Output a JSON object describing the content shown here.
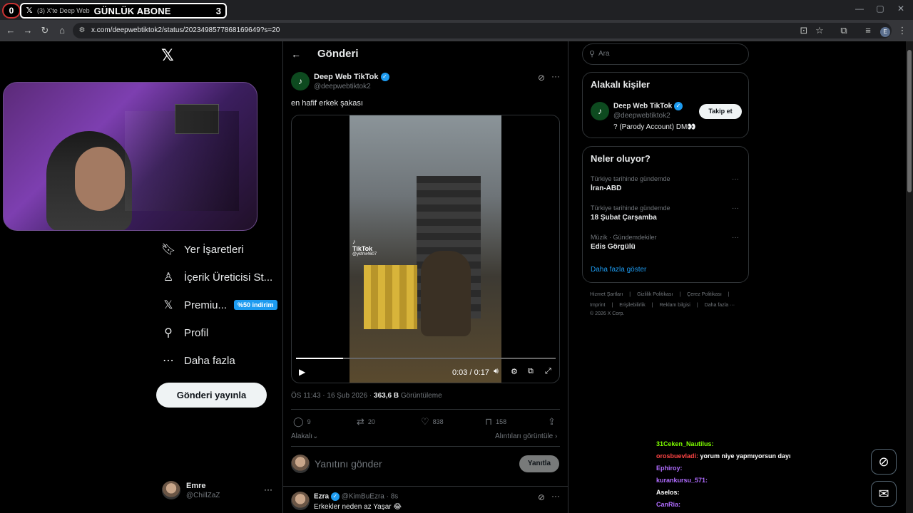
{
  "browser": {
    "counter_left": "0",
    "tab_title": "(3) X'te Deep Web",
    "tab_banner": "GÜNLÜK ABONE",
    "tab_count": "3",
    "url": "x.com/deepwebtiktok2/status/2023498577868169649?s=20",
    "profile_initial": "E"
  },
  "nav": {
    "bookmarks": "Yer İşaretleri",
    "creator_studio": "İçerik Üreticisi St...",
    "premium": "Premiu...",
    "premium_badge": "%50 indirim",
    "profile": "Profil",
    "more": "Daha fazla",
    "post_button": "Gönderi yayınla",
    "user_name": "Emre",
    "user_handle": "@ChillZaZ"
  },
  "post": {
    "header_title": "Gönderi",
    "author_name": "Deep Web TikTok",
    "author_handle": "@deepwebtiktok2",
    "text": "en hafif erkek şakası",
    "video_time": "0:03 / 0:17",
    "video_watermark": "TikTok",
    "video_watermark_user": "@ykfmr4607",
    "video_progress": 0.18,
    "meta_time": "ÖS 11:43 · 16 Şub 2026 · ",
    "meta_views": "363,6 B",
    "meta_views_label": " Görüntüleme",
    "replies": "9",
    "reposts": "20",
    "likes": "838",
    "bookmarks": "158",
    "related": "Alakalı",
    "view_quotes": "Alıntıları görüntüle",
    "reply_placeholder": "Yanıtını gönder",
    "reply_button": "Yanıtla"
  },
  "reply": {
    "name": "Ezra",
    "handle": "@KimBuEzra · 8s",
    "text": "Erkekler neden az Yaşar 😂"
  },
  "right": {
    "search_placeholder": "Ara",
    "related_people_title": "Alakalı kişiler",
    "person_name": "Deep Web TikTok",
    "person_handle": "@deepwebtiktok2",
    "person_bio": "? (Parody Account) DM👀",
    "follow_button": "Takip et",
    "trends_title": "Neler oluyor?",
    "trends": [
      {
        "meta": "Türkiye tarihinde gündemde",
        "title": "İran-ABD"
      },
      {
        "meta": "Türkiye tarihinde gündemde",
        "title": "18 Şubat Çarşamba"
      },
      {
        "meta": "Müzik · Gündemdekiler",
        "title": "Edis Görgülü"
      }
    ],
    "show_more": "Daha fazla göster",
    "footer_line1": [
      "Hizmet Şartları",
      "Gizlilik Politikası",
      "Çerez Politikası"
    ],
    "footer_line2": [
      "Imprint",
      "Erişilebilirlik",
      "Reklam bilgisi",
      "Daha fazla ···"
    ],
    "copyright": "© 2026 X Corp."
  },
  "chat": [
    {
      "user": "31Ceken_Nautilus:",
      "msg": "",
      "color": "#7fff00"
    },
    {
      "user": "orosbuevladi:",
      "msg": "yorum niye yapmıyorsun dayı",
      "color": "#ff4444"
    },
    {
      "user": "Ephiroy:",
      "msg": "",
      "color": "#b06cff"
    },
    {
      "user": "kurankursu_571:",
      "msg": "",
      "color": "#b06cff"
    },
    {
      "user": "Aselos:",
      "msg": "",
      "color": "#ffffff"
    },
    {
      "user": "CanRia:",
      "msg": "",
      "color": "#b06cff"
    }
  ],
  "colors": {
    "accent": "#1d9bf0",
    "background": "#000000",
    "border": "#2f3336"
  }
}
